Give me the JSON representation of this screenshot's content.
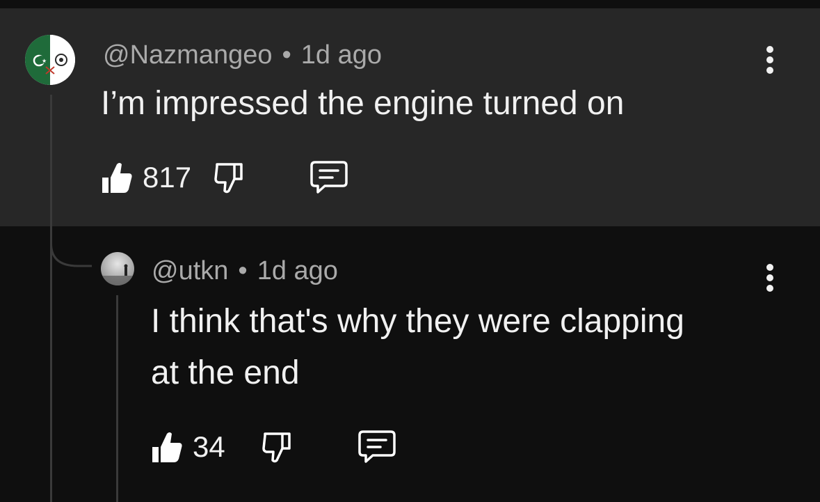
{
  "comments": [
    {
      "author": "@Nazmangeo",
      "separator": "•",
      "time": "1d ago",
      "text": "I’m impressed the engine turned on",
      "likes": "817",
      "icons": {
        "like": "thumbs-up-icon",
        "dislike": "thumbs-down-icon",
        "reply": "comment-icon",
        "menu": "more-vertical-icon"
      }
    },
    {
      "author": "@utkn",
      "separator": "•",
      "time": "1d ago",
      "text_line1": "I think that's why they were clapping",
      "text_line2": "at the end",
      "likes": "34",
      "icons": {
        "like": "thumbs-up-icon",
        "dislike": "thumbs-down-icon",
        "reply": "comment-icon",
        "menu": "more-vertical-icon"
      }
    }
  ],
  "colors": {
    "background": "#0f0f0f",
    "highlight_comment": "#272727",
    "text_primary": "#f1f1f1",
    "text_secondary": "#aaaaaa"
  }
}
